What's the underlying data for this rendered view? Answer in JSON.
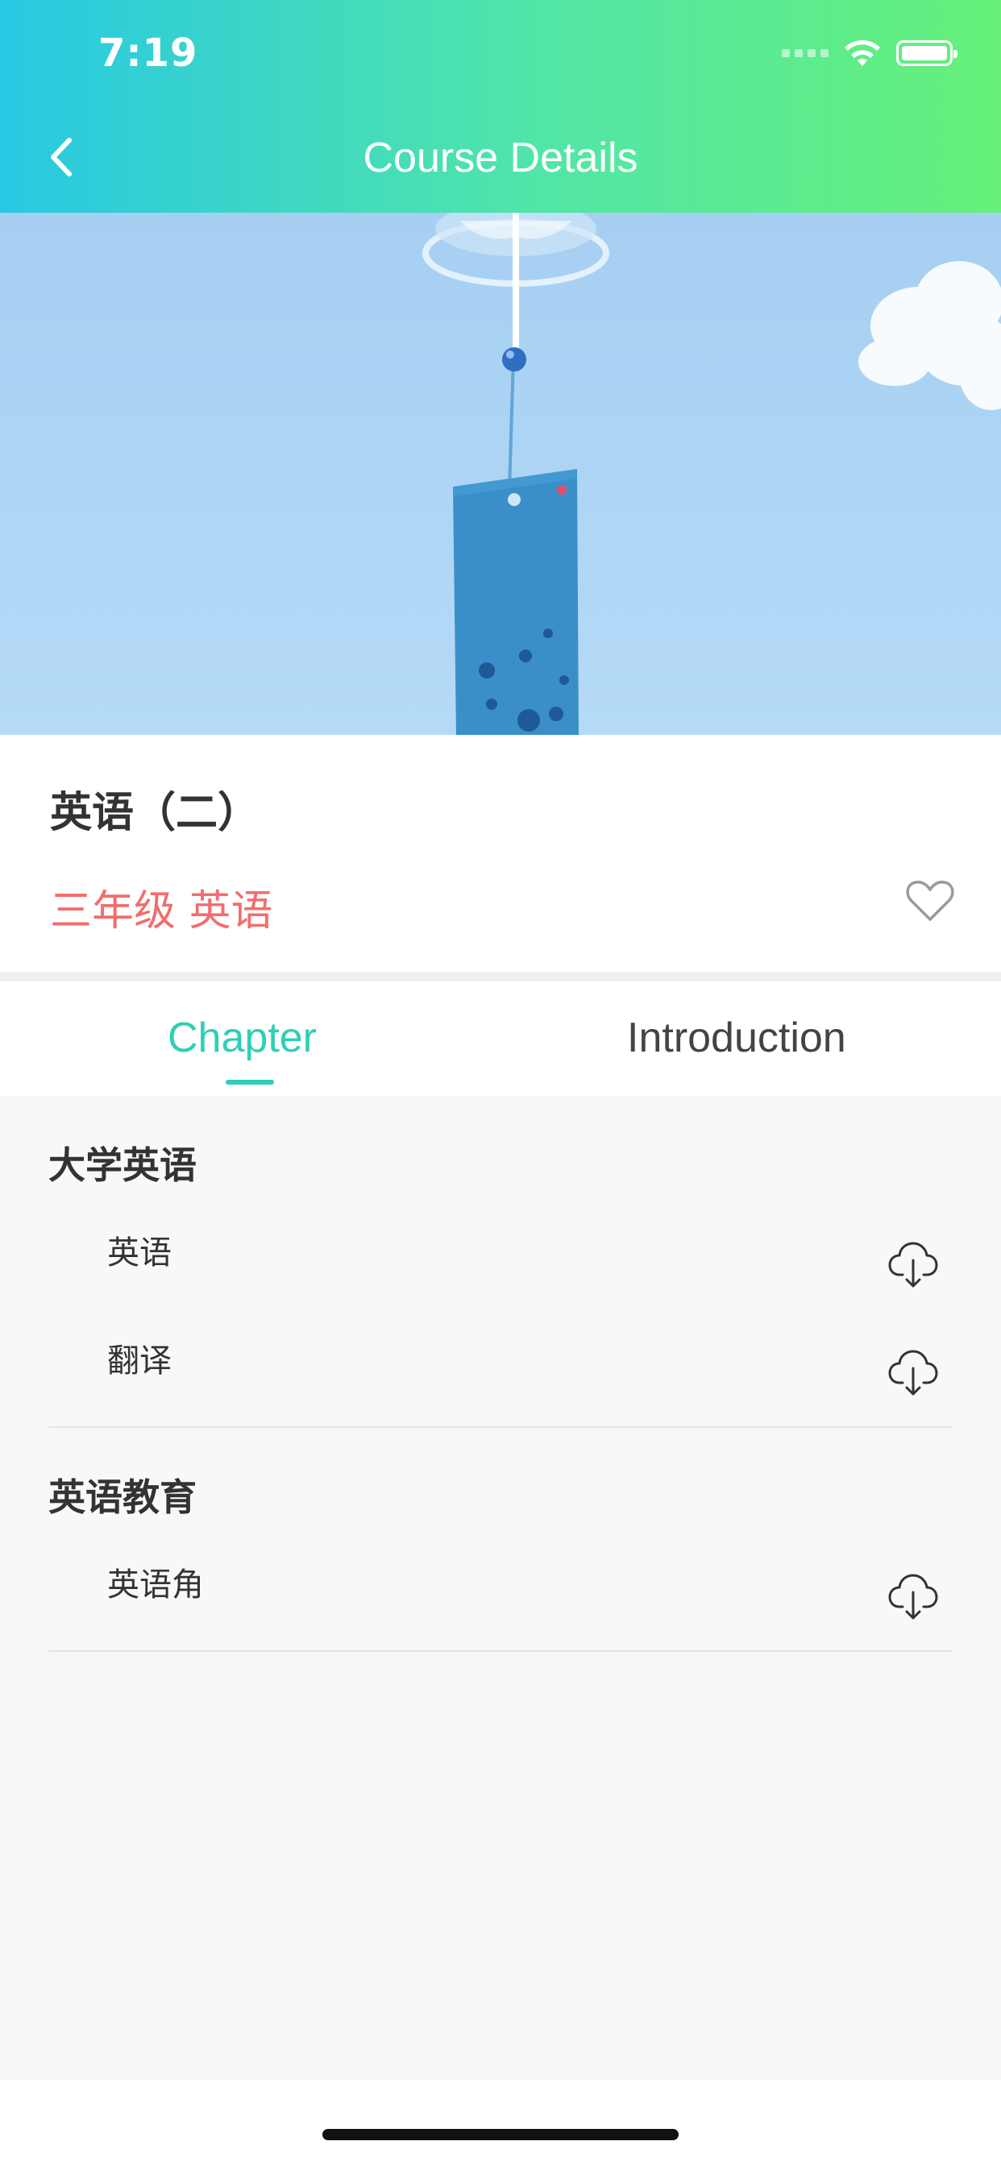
{
  "status_bar": {
    "time": "7:19"
  },
  "nav": {
    "title": "Course Details"
  },
  "course": {
    "title": "英语（二）",
    "meta": "三年级 英语",
    "accent_color": "#f26d6d"
  },
  "tabs": [
    {
      "label": "Chapter",
      "active": true
    },
    {
      "label": "Introduction",
      "active": false
    }
  ],
  "theme": {
    "active_tab_color": "#2fcfb5"
  },
  "chapters": [
    {
      "title": "大学英语",
      "lessons": [
        {
          "label": "英语",
          "icon": "cloud-download-icon"
        },
        {
          "label": "翻译",
          "icon": "cloud-download-icon"
        }
      ]
    },
    {
      "title": "英语教育",
      "lessons": [
        {
          "label": "英语角",
          "icon": "cloud-download-icon"
        }
      ]
    }
  ]
}
